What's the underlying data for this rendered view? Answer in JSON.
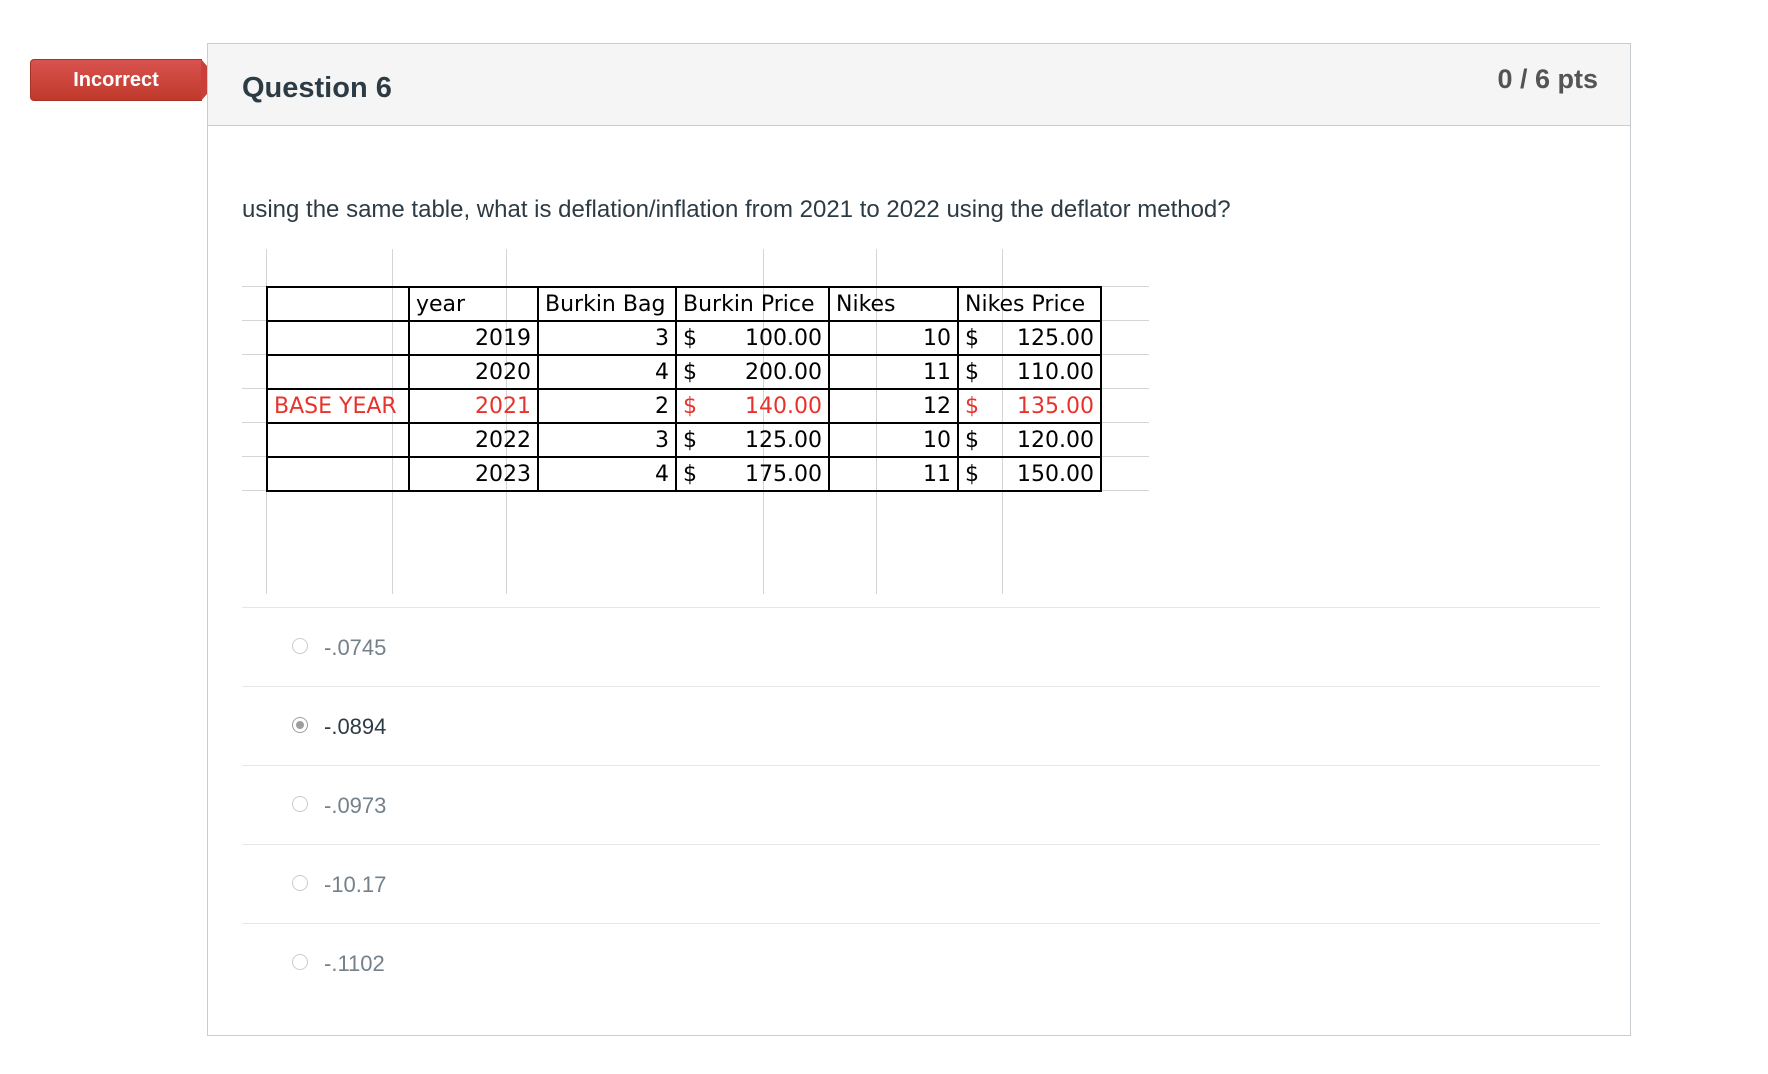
{
  "status_badge": "Incorrect",
  "question": {
    "title": "Question 6",
    "points": "0 / 6 pts",
    "text": "using the same table, what is deflation/inflation from 2021 to 2022 using the deflator method?"
  },
  "table": {
    "headers": [
      "",
      "year",
      "Burkin Bag",
      "Burkin Price",
      "Nikes",
      "Nikes Price"
    ],
    "rows": [
      {
        "label": "",
        "year": "2019",
        "burkin_bag": "3",
        "burkin_price_sym": "$",
        "burkin_price": "100.00",
        "nikes": "10",
        "nikes_price_sym": "$",
        "nikes_price": "125.00"
      },
      {
        "label": "",
        "year": "2020",
        "burkin_bag": "4",
        "burkin_price_sym": "$",
        "burkin_price": "200.00",
        "nikes": "11",
        "nikes_price_sym": "$",
        "nikes_price": "110.00"
      },
      {
        "label": "BASE YEAR",
        "year": "2021",
        "burkin_bag": "2",
        "burkin_price_sym": "$",
        "burkin_price": "140.00",
        "nikes": "12",
        "nikes_price_sym": "$",
        "nikes_price": "135.00"
      },
      {
        "label": "",
        "year": "2022",
        "burkin_bag": "3",
        "burkin_price_sym": "$",
        "burkin_price": "125.00",
        "nikes": "10",
        "nikes_price_sym": "$",
        "nikes_price": "120.00"
      },
      {
        "label": "",
        "year": "2023",
        "burkin_bag": "4",
        "burkin_price_sym": "$",
        "burkin_price": "175.00",
        "nikes": "11",
        "nikes_price_sym": "$",
        "nikes_price": "150.00"
      }
    ],
    "highlight_color": "#e8332c"
  },
  "answers": [
    {
      "label": "-.0745",
      "selected": false
    },
    {
      "label": "-.0894",
      "selected": true
    },
    {
      "label": "-.0973",
      "selected": false
    },
    {
      "label": "-10.17",
      "selected": false
    },
    {
      "label": "-.1102",
      "selected": false
    }
  ],
  "colors": {
    "badge": "#c9403a",
    "header_bg": "#f5f5f5",
    "text": "#2d3b45"
  }
}
